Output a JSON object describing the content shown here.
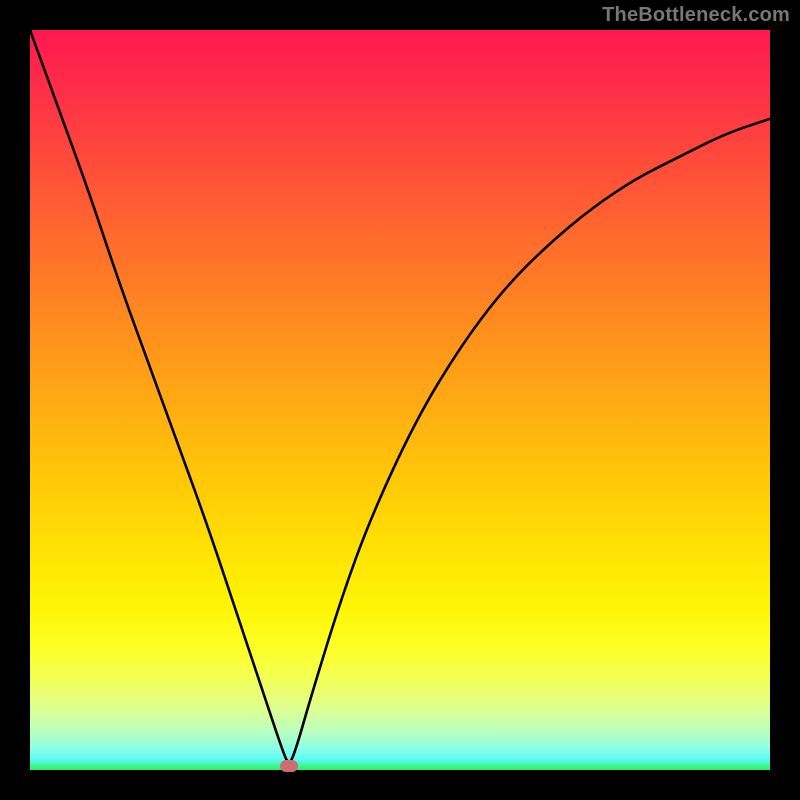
{
  "watermark": {
    "text": "TheBottleneck.com"
  },
  "chart_data": {
    "type": "line",
    "title": "",
    "xlabel": "",
    "ylabel": "",
    "xlim": [
      0,
      100
    ],
    "ylim": [
      0,
      100
    ],
    "grid": false,
    "legend": false,
    "background": "vertical-gradient red→orange→yellow→green",
    "annotations": [
      {
        "name": "minimum-marker",
        "x": 35,
        "y": 0.5,
        "shape": "rounded-pill",
        "color": "#cc6e6e"
      }
    ],
    "series": [
      {
        "name": "bottleneck-curve",
        "x": [
          0,
          4,
          8,
          12,
          16,
          20,
          24,
          28,
          32,
          34,
          35,
          36,
          38,
          42,
          46,
          52,
          58,
          64,
          70,
          76,
          82,
          88,
          94,
          100
        ],
        "y": [
          100,
          89,
          78,
          66,
          55,
          44,
          33,
          21,
          9,
          3,
          0.5,
          3,
          10,
          23,
          34,
          47,
          57,
          65,
          71,
          76,
          80,
          83,
          86,
          88
        ]
      }
    ]
  }
}
